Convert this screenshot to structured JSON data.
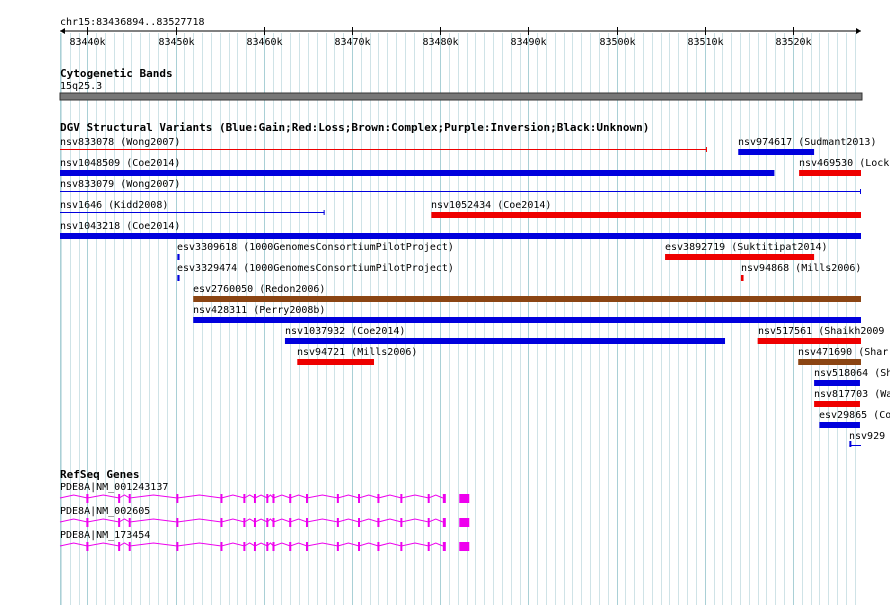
{
  "region": {
    "label": "chr15:83436894..83527718",
    "start": 83436894,
    "end": 83527718
  },
  "ruler": {
    "ticks": [
      {
        "pos": 83440000,
        "label": "83440k"
      },
      {
        "pos": 83450000,
        "label": "83450k"
      },
      {
        "pos": 83460000,
        "label": "83460k"
      },
      {
        "pos": 83470000,
        "label": "83470k"
      },
      {
        "pos": 83480000,
        "label": "83480k"
      },
      {
        "pos": 83490000,
        "label": "83490k"
      },
      {
        "pos": 83500000,
        "label": "83500k"
      },
      {
        "pos": 83510000,
        "label": "83510k"
      },
      {
        "pos": 83520000,
        "label": "83520k"
      }
    ]
  },
  "cytobands": {
    "title": "Cytogenetic Bands",
    "band_label": "15q25.3",
    "band_color": "#777777"
  },
  "dgv": {
    "title": "DGV Structural Variants (Blue:Gain;Red:Loss;Brown:Complex;Purple:Inversion;Black:Unknown)",
    "colors": {
      "gain": "#0000dd",
      "loss": "#ee0000",
      "complex": "#8b4513"
    },
    "variants": [
      {
        "label": "nsv833078 (Wong2007)",
        "start": 83436894,
        "end": 83510250,
        "color": "loss",
        "style": "thin",
        "row": 0
      },
      {
        "label": "nsv974617 (Sudmant2013)",
        "start": 83513800,
        "end": 83522400,
        "color": "gain",
        "style": "thick",
        "row": 0
      },
      {
        "label": "nsv1048509 (Coe2014)",
        "start": 83436894,
        "end": 83517900,
        "color": "gain",
        "style": "thick",
        "row": 1
      },
      {
        "label": "nsv469530 (Lock",
        "start": 83520700,
        "end": 83527718,
        "color": "loss",
        "style": "thick",
        "row": 1
      },
      {
        "label": "nsv833079 (Wong2007)",
        "start": 83436894,
        "end": 83527718,
        "color": "gain",
        "style": "thin",
        "row": 2
      },
      {
        "label": "nsv1646 (Kidd2008)",
        "start": 83436894,
        "end": 83466900,
        "color": "gain",
        "style": "thin",
        "row": 3
      },
      {
        "label": "nsv1052434 (Coe2014)",
        "start": 83479000,
        "end": 83527718,
        "color": "loss",
        "style": "thick",
        "row": 3
      },
      {
        "label": "nsv1043218 (Coe2014)",
        "start": 83436894,
        "end": 83527718,
        "color": "gain",
        "style": "thick",
        "row": 4
      },
      {
        "label": "esv3309618 (1000GenomesConsortiumPilotProject)",
        "start": 83450200,
        "end": 83450450,
        "color": "gain",
        "style": "thick",
        "row": 5
      },
      {
        "label": "esv3892719 (Suktitipat2014)",
        "start": 83505500,
        "end": 83522400,
        "color": "loss",
        "style": "thick",
        "row": 5
      },
      {
        "label": "esv3329474 (1000GenomesConsortiumPilotProject)",
        "start": 83450200,
        "end": 83450450,
        "color": "gain",
        "style": "thick",
        "row": 6
      },
      {
        "label": "nsv94868 (Mills2006)",
        "start": 83514100,
        "end": 83514400,
        "color": "loss",
        "style": "thick",
        "row": 6
      },
      {
        "label": "esv2760050 (Redon2006)",
        "start": 83452000,
        "end": 83527718,
        "color": "complex",
        "style": "thick",
        "row": 7
      },
      {
        "label": "nsv428311 (Perry2008b)",
        "start": 83452000,
        "end": 83527718,
        "color": "gain",
        "style": "thick",
        "row": 8
      },
      {
        "label": "nsv1037932 (Coe2014)",
        "start": 83462400,
        "end": 83512300,
        "color": "gain",
        "style": "thick",
        "row": 9
      },
      {
        "label": "nsv517561 (Shaikh2009",
        "start": 83516000,
        "end": 83527718,
        "color": "loss",
        "style": "thick",
        "row": 9
      },
      {
        "label": "nsv94721 (Mills2006)",
        "start": 83463800,
        "end": 83472500,
        "color": "loss",
        "style": "thick",
        "row": 10
      },
      {
        "label": "nsv471690 (Shar",
        "start": 83520600,
        "end": 83527718,
        "color": "complex",
        "style": "thick",
        "row": 10
      },
      {
        "label": "nsv518064 (Sh",
        "start": 83522400,
        "end": 83527600,
        "color": "gain",
        "style": "thick",
        "row": 11
      },
      {
        "label": "nsv817703 (Wa",
        "start": 83522400,
        "end": 83527600,
        "color": "loss",
        "style": "thick",
        "row": 12
      },
      {
        "label": "esv29865 (Co",
        "start": 83523000,
        "end": 83527600,
        "color": "gain",
        "style": "thick",
        "row": 13
      },
      {
        "label": "nsv929",
        "start": 83526400,
        "end": 83527718,
        "color": "gain",
        "style": "tiny",
        "row": 14
      }
    ]
  },
  "refseq": {
    "title": "RefSeq Genes",
    "color": "#ee00ee",
    "genes": [
      {
        "label": "PDE8A|NM_001243137",
        "start": 83436894,
        "end": 83483300
      },
      {
        "label": "PDE8A|NM_002605",
        "start": 83436894,
        "end": 83483300
      },
      {
        "label": "PDE8A|NM_173454",
        "start": 83436894,
        "end": 83483300
      }
    ],
    "exons": [
      83440000,
      83443600,
      83444800,
      83450200,
      83455200,
      83457800,
      83459000,
      83460400,
      83461100,
      83463000,
      83464900,
      83468400,
      83470800,
      83473000,
      83475600,
      83478700
    ]
  }
}
